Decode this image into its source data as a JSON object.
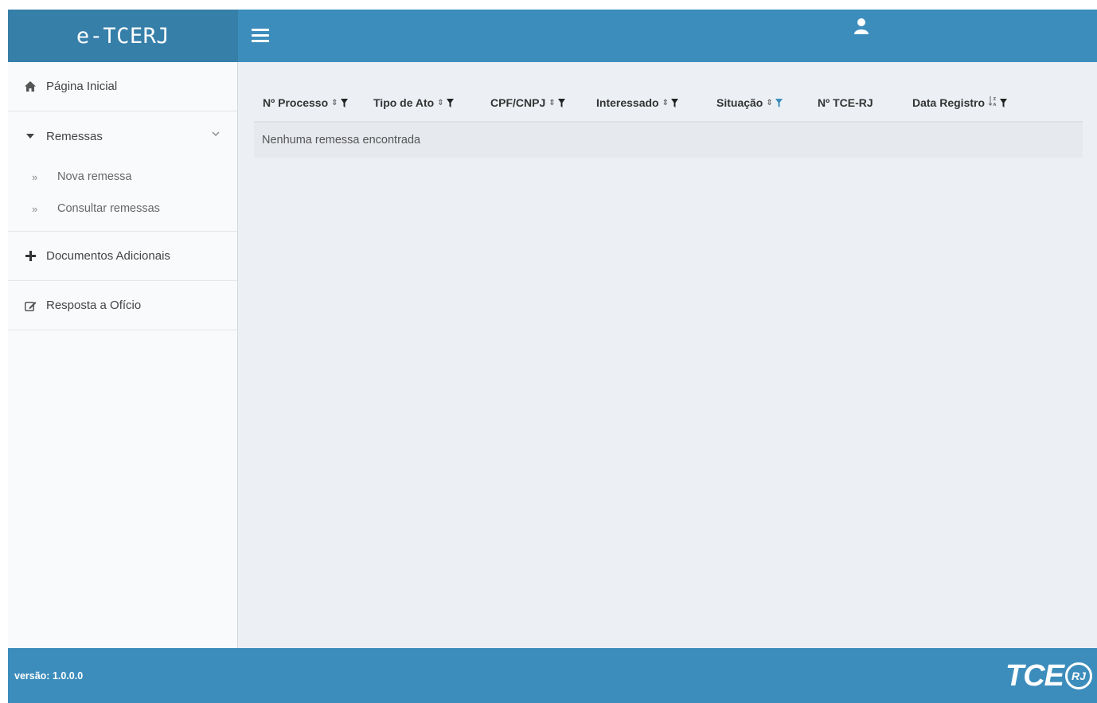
{
  "header": {
    "logo_text": "e-TCERJ",
    "menu_toggle_icon": "hamburger-icon",
    "user_icon": "user-icon"
  },
  "sidebar": {
    "items": [
      {
        "label": "Página Inicial",
        "icon": "home-icon"
      },
      {
        "label": "Remessas",
        "icon": "caret-down-icon",
        "expanded": true,
        "children": [
          {
            "label": "Nova remessa",
            "icon": "angle-double-right-icon"
          },
          {
            "label": "Consultar remessas",
            "icon": "angle-double-right-icon"
          }
        ]
      },
      {
        "label": "Documentos Adicionais",
        "icon": "plus-icon"
      },
      {
        "label": "Resposta a Ofício",
        "icon": "edit-icon"
      }
    ]
  },
  "table": {
    "columns": [
      {
        "label": "Nº Processo",
        "sortable": true,
        "filter": true
      },
      {
        "label": "Tipo de Ato",
        "sortable": true,
        "filter": true
      },
      {
        "label": "CPF/CNPJ",
        "sortable": true,
        "filter": true
      },
      {
        "label": "Interessado",
        "sortable": true,
        "filter": true
      },
      {
        "label": "Situação",
        "sortable": true,
        "filter": true,
        "filter_active": true
      },
      {
        "label": "Nº TCE-RJ",
        "sortable": false,
        "filter": false
      },
      {
        "label": "Data Registro",
        "sortable": true,
        "sort_icon": "sort-alpha-icon",
        "filter": true
      }
    ],
    "empty_message": "Nenhuma remessa encontrada"
  },
  "footer": {
    "version": "versão: 1.0.0.0",
    "brand_text": "TCE",
    "brand_badge": "RJ"
  },
  "colors": {
    "primary": "#3c8dbc",
    "logo_bg": "#367fa9",
    "content_bg": "#ecf0f5",
    "filter_active": "#3c8dbc"
  }
}
